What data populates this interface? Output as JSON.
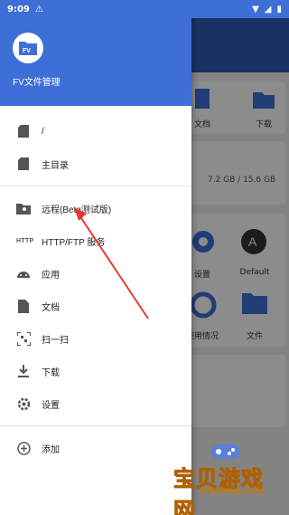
{
  "status_bar": {
    "time": "9:09"
  },
  "drawer": {
    "app_name": "FV文件管理",
    "logo_text": "FV",
    "items": [
      {
        "label": "/",
        "icon": "sd-card-icon"
      },
      {
        "label": "主目录",
        "icon": "sd-card-icon"
      },
      {
        "label": "远程(Beta测试版)",
        "icon": "remote-folder-icon"
      },
      {
        "label": "HTTP/FTP 服务",
        "icon_text": "HTTP"
      },
      {
        "label": "应用",
        "icon": "android-icon"
      },
      {
        "label": "文档",
        "icon": "document-icon"
      },
      {
        "label": "扫一扫",
        "icon": "scan-icon"
      },
      {
        "label": "下载",
        "icon": "download-icon"
      },
      {
        "label": "设置",
        "icon": "gear-icon"
      },
      {
        "label": "添加",
        "icon": "add-circle-icon"
      }
    ]
  },
  "background": {
    "doc_label": "文档",
    "download_label": "下载",
    "storage_text": "7.2 GB / 15.6 GB",
    "settings_label": "设置",
    "default_label": "Default",
    "usage_label": "使用情况",
    "files_label": "文件"
  },
  "watermark": {
    "title": "宝贝游戏网",
    "url": "baobeiy.com"
  },
  "colors": {
    "primary": "#3d6fd6",
    "annotation": "#e53935",
    "watermark": "#f4b400"
  }
}
